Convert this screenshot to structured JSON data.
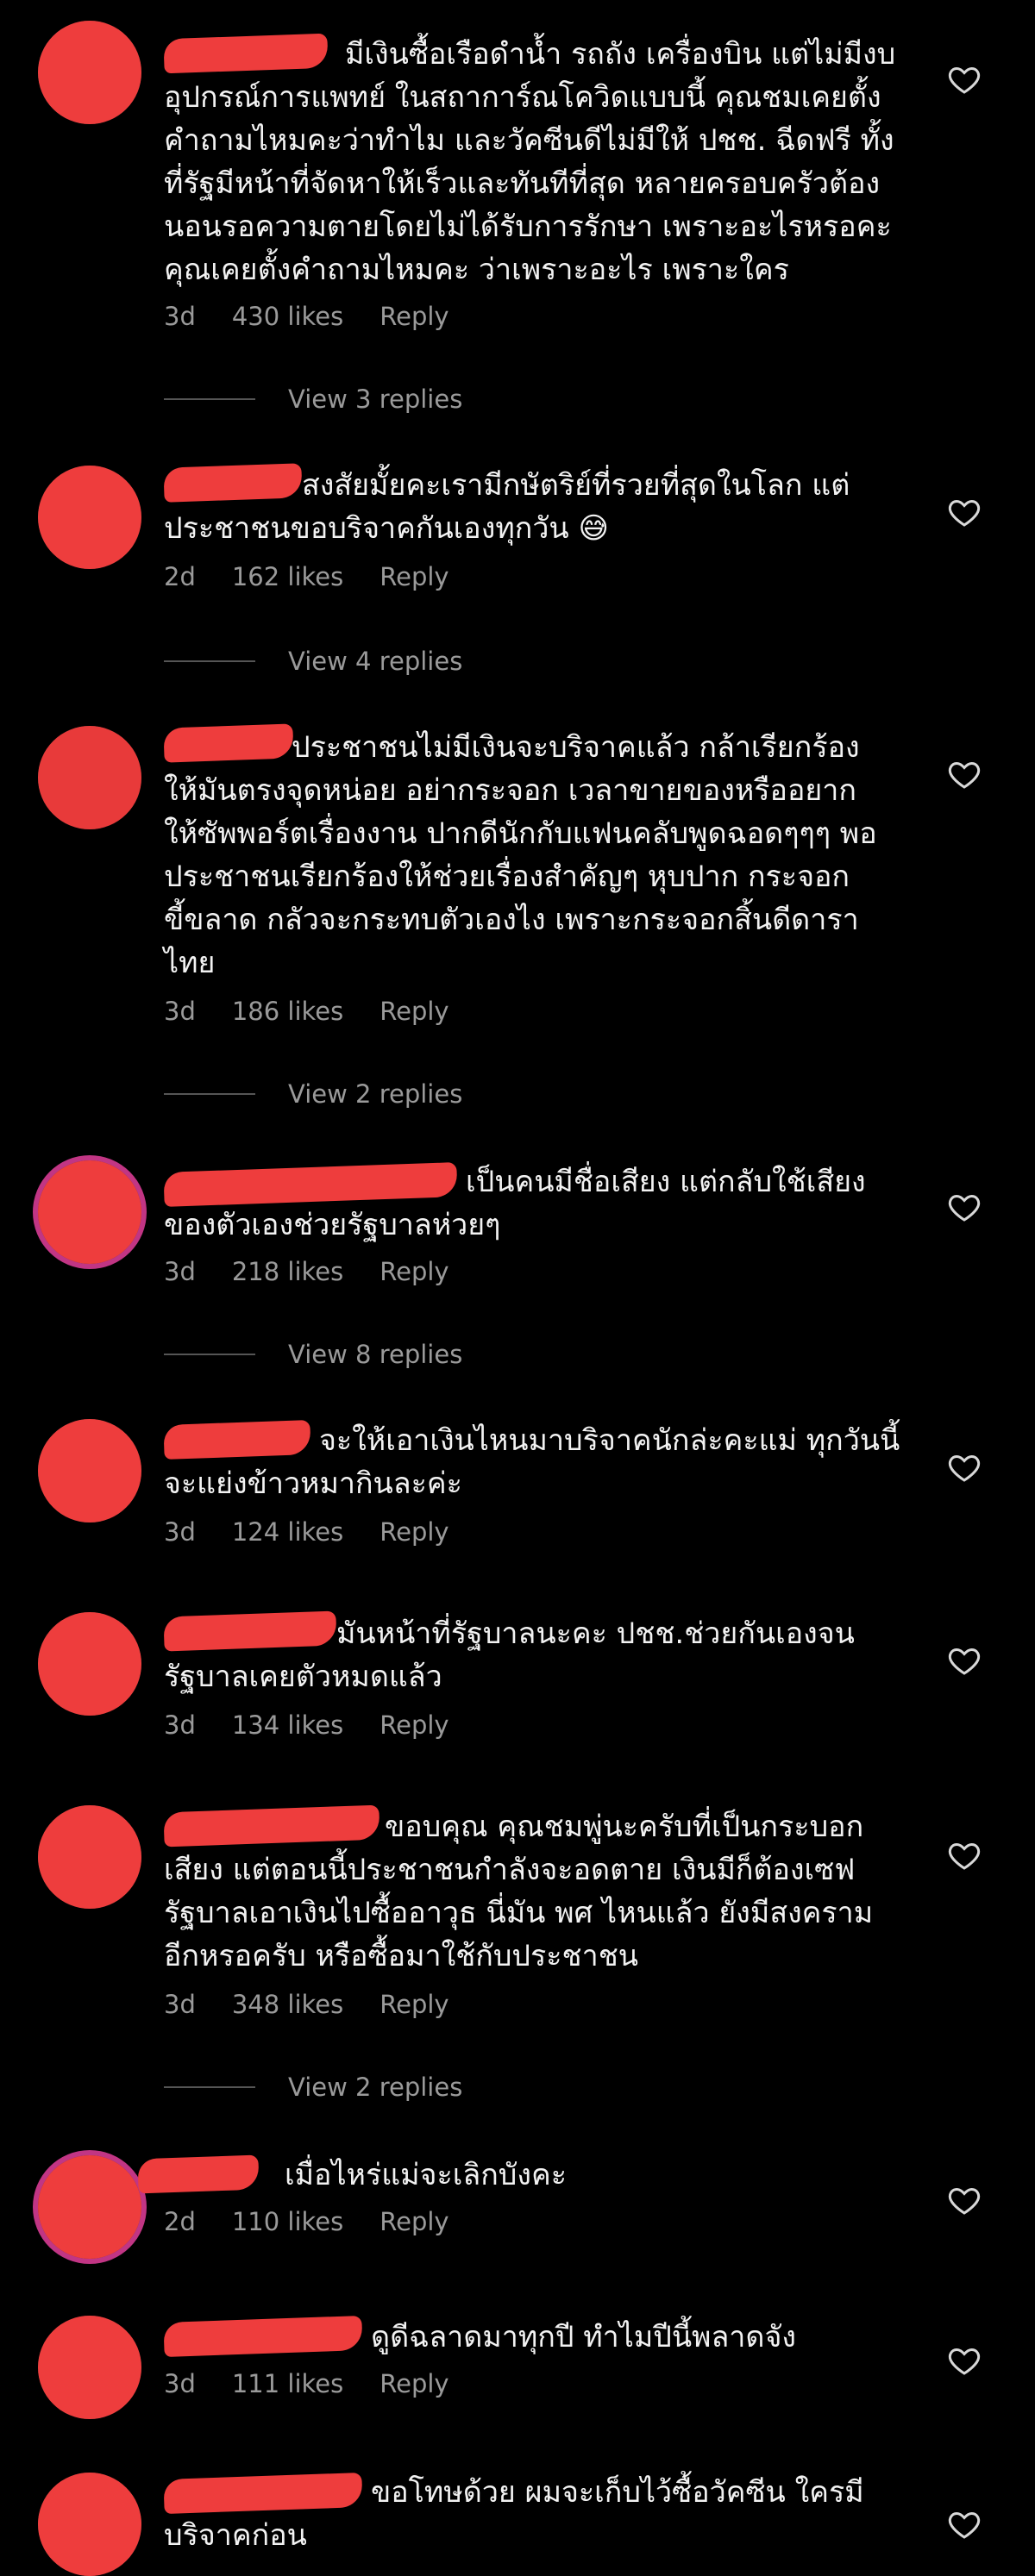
{
  "comments": [
    {
      "text": "มีเงินซื้อเรือดำน้ำ รถถัง เครื่องบิน แต่ไม่มีงบ\nอุปกรณ์การแพทย์ ในสถาการ์ณโควิดแบบนี้ คุณชมเคยตั้ง\nคำถามไหมคะว่าทำไม และวัคซีนดีไม่มีให้ ปชช. ฉีดฟรี ทั้ง\nที่รัฐมีหน้าที่จัดหาให้เร็วและทันทีที่สุด หลายครอบครัวต้อง\nนอนรอความตายโดยไม่ได้รับการรักษา เพราะอะไรหรอคะ\nคุณเคยตั้งคำถามไหมคะ ว่าเพราะอะไร เพราะใคร",
      "time": "3d",
      "likes": "430 likes",
      "reply": "Reply",
      "view_replies": "View 3 replies"
    },
    {
      "text": "สงสัยมั้ยคะเรามีกษัตริย์ที่รวยที่สุดในโลก แต่\nประชาชนขอบริจาคกันเองทุกวัน 😅",
      "time": "2d",
      "likes": "162 likes",
      "reply": "Reply",
      "view_replies": "View 4 replies"
    },
    {
      "text": "ประชาชนไม่มีเงินจะบริจาคแล้ว กล้าเรียกร้อง\nให้มันตรงจุดหน่อย อย่ากระจอก เวลาขายของหรืออยาก\nให้ซัพพอร์ตเรื่องงาน ปากดีนักกับแฟนคลับพูดฉอดๆๆๆ พอ\nประชาชนเรียกร้องให้ช่วยเรื่องสำคัญๆ หุบปาก กระจอก\nขี้ขลาด กลัวจะกระทบตัวเองไง เพราะกระจอกสิ้นดีดารา\nไทย",
      "time": "3d",
      "likes": "186 likes",
      "reply": "Reply",
      "view_replies": "View 2 replies"
    },
    {
      "text": "เป็นคนมีชื่อเสียง แต่กลับใช้เสียง\nของตัวเองช่วยรัฐบาลห่วยๆ",
      "time": "3d",
      "likes": "218 likes",
      "reply": "Reply",
      "view_replies": "View 8 replies"
    },
    {
      "text": "จะให้เอาเงินไหนมาบริจาคนักล่ะคะแม่ ทุกวันนี้\nจะแย่งข้าวหมากินละค่ะ",
      "time": "3d",
      "likes": "124 likes",
      "reply": "Reply",
      "view_replies": ""
    },
    {
      "text": "มันหน้าที่รัฐบาลนะคะ ปชช.ช่วยกันเองจน\nรัฐบาลเคยตัวหมดแล้ว",
      "time": "3d",
      "likes": "134 likes",
      "reply": "Reply",
      "view_replies": ""
    },
    {
      "text": "ขอบคุณ คุณชมพู่นะครับที่เป็นกระบอก\nเสียง แต่ตอนนี้ประชาชนกำลังจะอดตาย เงินมีก็ต้องเซฟ\nรัฐบาลเอาเงินไปซื้ออาวุธ นี่มัน พศ ไหนแล้ว ยังมีสงคราม\nอีกหรอครับ หรือซื้อมาใช้กับประชาชน",
      "time": "3d",
      "likes": "348 likes",
      "reply": "Reply",
      "view_replies": "View 2 replies"
    },
    {
      "text": "เมื่อไหร่แม่จะเลิกบังคะ",
      "time": "2d",
      "likes": "110 likes",
      "reply": "Reply",
      "view_replies": ""
    },
    {
      "text": "ดูดีฉลาดมาทุกปี ทำไมปีนี้พลาดจัง",
      "time": "3d",
      "likes": "111 likes",
      "reply": "Reply",
      "view_replies": ""
    },
    {
      "text": "ขอโทษด้วย ผมจะเก็บไว้ซื้อวัคซีน ใครมี\nบริจาคก่อน",
      "time": "",
      "likes": "",
      "reply": "",
      "view_replies": ""
    }
  ],
  "colors": {
    "background": "#000000",
    "text": "#f2f2f2",
    "meta": "#9a9a9a",
    "redaction": "#ee3d3d"
  },
  "icons": {
    "like": "heart-outline-icon"
  }
}
